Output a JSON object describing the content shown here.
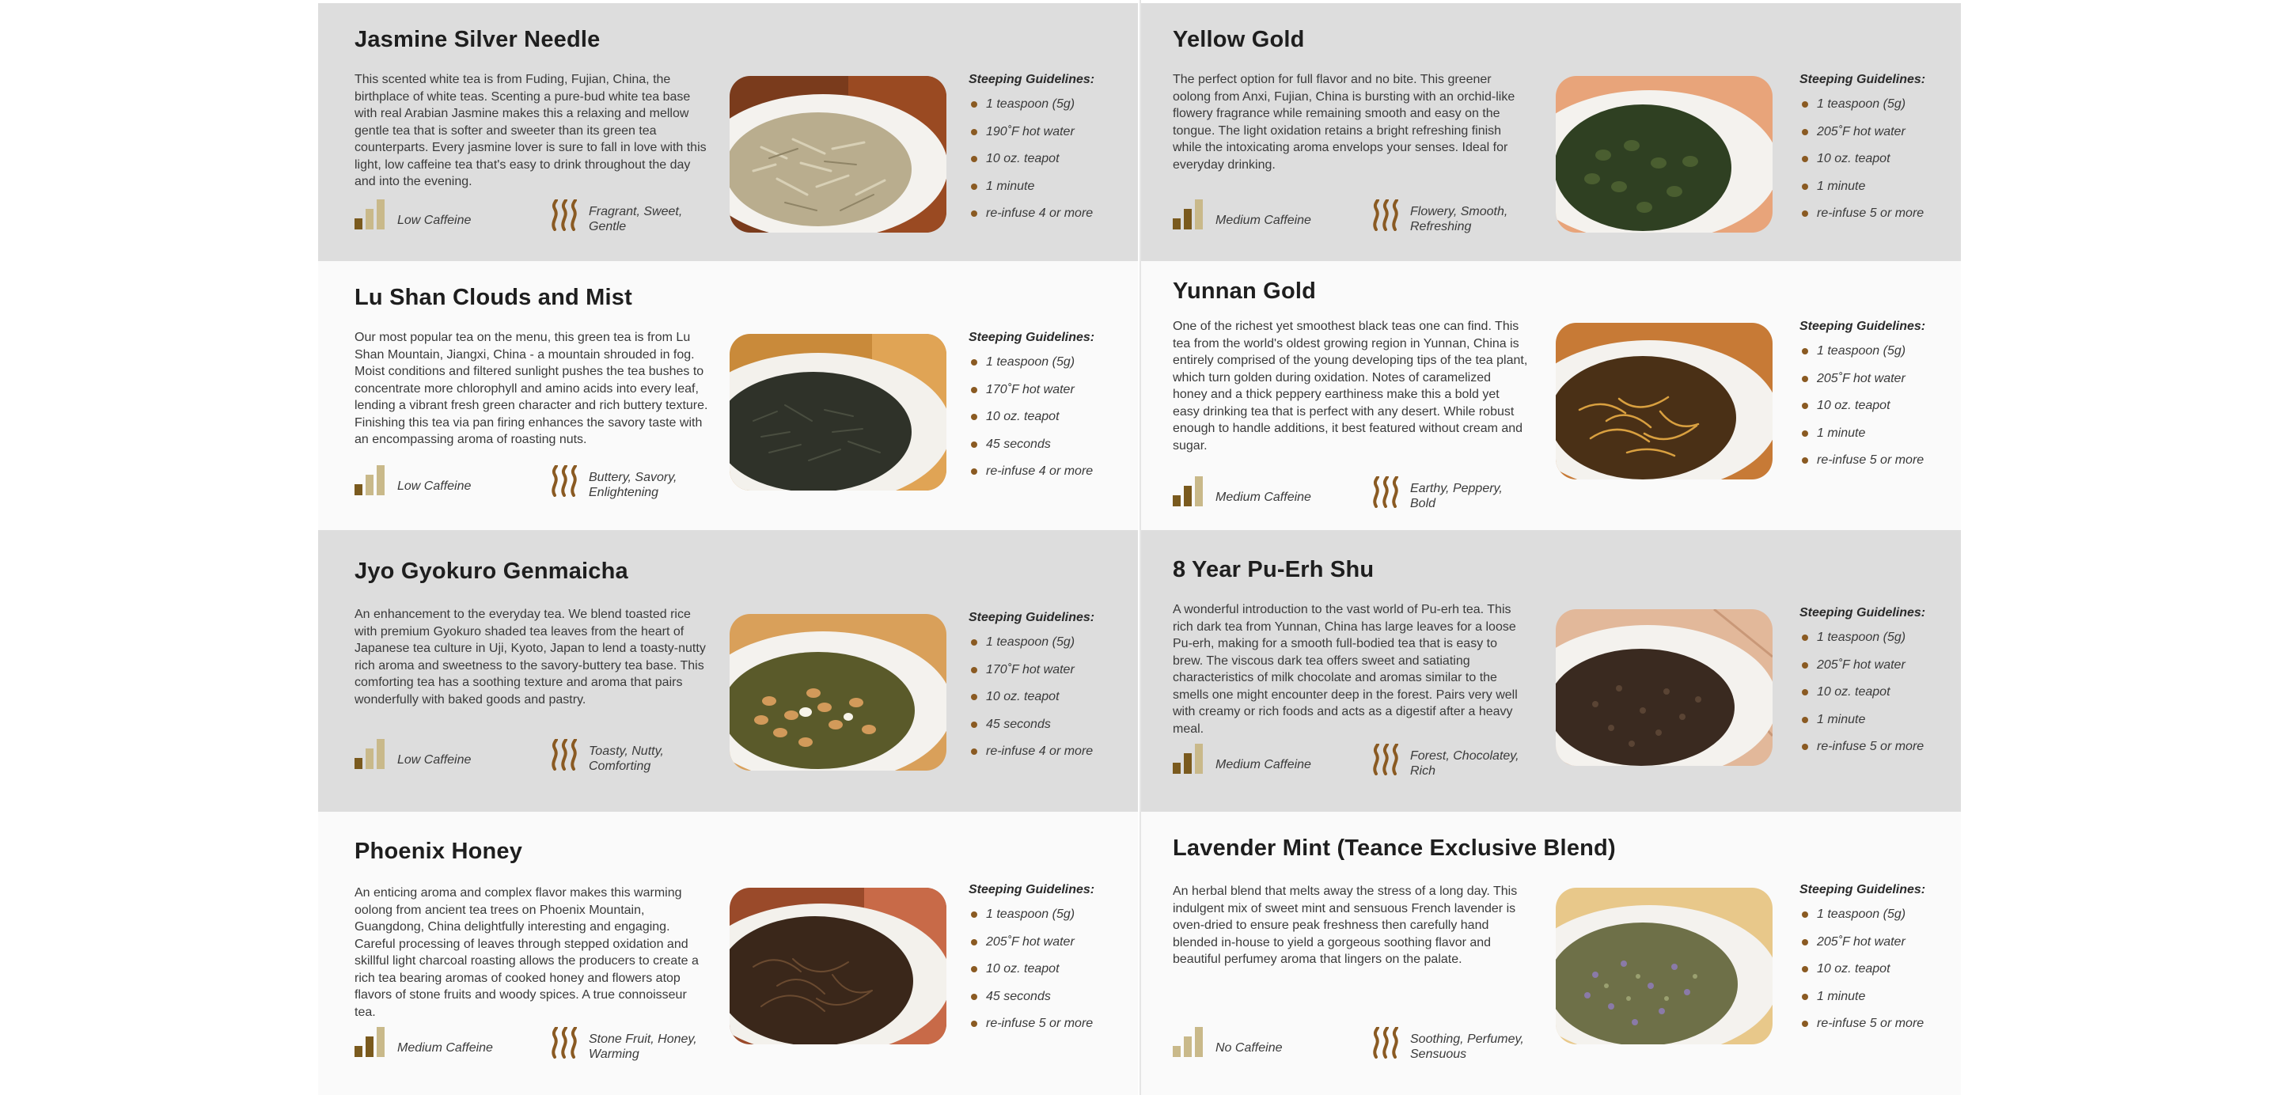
{
  "menu": {
    "steep_heading": "Steeping Guidelines:",
    "left_cards": [
      {
        "name": "Jasmine Silver Needle",
        "description": "This scented white tea is from Fuding, Fujian, China, the birthplace of white teas. Scenting a pure-bud white tea base with real Arabian Jasmine makes this a relaxing and mellow gentle tea that is softer and sweeter than its green tea counterparts. Every jasmine lover is sure to fall in love with this light, low caffeine tea that's easy to drink throughout the day and into the evening.",
        "steeping": [
          "1 teaspoon (5g)",
          "190˚F hot water",
          "10 oz. teapot",
          "1 minute",
          "re-infuse 4 or more"
        ],
        "caffeine": "Low Caffeine",
        "flavor": "Fragrant, Sweet, Gentle"
      },
      {
        "name": "Lu Shan Clouds and Mist",
        "description": "Our most popular tea on the menu, this green tea is from Lu Shan Mountain, Jiangxi, China - a mountain shrouded in fog. Moist conditions and filtered sunlight pushes the tea bushes to concentrate more chlorophyll and amino acids into every leaf, lending a vibrant fresh green character and rich buttery texture. Finishing this tea via pan firing enhances the savory taste with an encompassing aroma of roasting nuts.",
        "steeping": [
          "1 teaspoon (5g)",
          "170˚F hot water",
          "10 oz. teapot",
          "45 seconds",
          "re-infuse 4 or more"
        ],
        "caffeine": "Low Caffeine",
        "flavor": "Buttery, Savory, Enlightening"
      },
      {
        "name": "Jyo Gyokuro Genmaicha",
        "description": "An enhancement to the everyday tea. We blend toasted rice with premium Gyokuro shaded tea leaves from the heart of Japanese tea culture in Uji, Kyoto, Japan to lend a toasty-nutty rich aroma and sweetness to the savory-buttery tea base. This comforting tea has a soothing texture and aroma that pairs wonderfully with baked goods and pastry.",
        "steeping": [
          "1 teaspoon (5g)",
          "170˚F hot water",
          "10 oz. teapot",
          "45 seconds",
          "re-infuse 4 or more"
        ],
        "caffeine": "Low Caffeine",
        "flavor": "Toasty, Nutty, Comforting"
      },
      {
        "name": "Phoenix Honey",
        "description": "An enticing aroma and complex flavor makes this warming oolong from ancient tea trees on Phoenix Mountain, Guangdong, China delightfully interesting and engaging. Careful processing of leaves through stepped oxidation and skillful light charcoal roasting allows the producers to create a rich tea bearing aromas of cooked honey and flowers atop flavors of stone fruits and woody spices. A true connoisseur tea.",
        "steeping": [
          "1 teaspoon (5g)",
          "205˚F hot water",
          "10 oz. teapot",
          "45 seconds",
          "re-infuse 5 or more"
        ],
        "caffeine": "Medium Caffeine",
        "flavor": "Stone Fruit, Honey, Warming"
      }
    ],
    "right_cards": [
      {
        "name": "Yellow Gold",
        "description": "The perfect option for full flavor and no bite. This greener oolong from Anxi, Fujian, China is bursting with an orchid-like flowery fragrance while remaining smooth and easy on the tongue. The light oxidation retains a bright refreshing finish while the intoxicating aroma envelops your senses. Ideal for everyday drinking.",
        "steeping": [
          "1 teaspoon (5g)",
          "205˚F hot water",
          "10 oz. teapot",
          "1 minute",
          "re-infuse 5 or more"
        ],
        "caffeine": "Medium Caffeine",
        "flavor": "Flowery, Smooth, Refreshing"
      },
      {
        "name": "Yunnan Gold",
        "description": "One of the richest yet smoothest black teas one can find. This tea from the world's oldest growing region in Yunnan, China is entirely comprised of the young developing tips of the tea plant, which turn golden during oxidation. Notes of caramelized honey and a thick peppery earthiness make this a bold yet easy drinking tea that is perfect with any desert. While robust enough to handle additions, it best featured without cream and sugar.",
        "steeping": [
          "1 teaspoon (5g)",
          "205˚F hot water",
          "10 oz. teapot",
          "1 minute",
          "re-infuse 5 or more"
        ],
        "caffeine": "Medium Caffeine",
        "flavor": "Earthy, Peppery, Bold"
      },
      {
        "name": "8 Year Pu-Erh Shu",
        "description": "A wonderful introduction to the vast world of Pu-erh tea. This rich dark tea from Yunnan, China has large leaves for a loose Pu-erh, making for a smooth full-bodied tea that is easy to brew. The viscous dark tea offers sweet and satiating characteristics of milk chocolate and aromas similar to the smells one might encounter deep in the forest. Pairs very well with creamy or rich foods and acts as a digestif after a heavy meal.",
        "steeping": [
          "1 teaspoon (5g)",
          "205˚F hot water",
          "10 oz. teapot",
          "1 minute",
          "re-infuse 5 or more"
        ],
        "caffeine": "Medium Caffeine",
        "flavor": "Forest, Chocolatey, Rich"
      },
      {
        "name": "Lavender Mint (Teance Exclusive Blend)",
        "description": "An herbal blend that melts away the stress of a long day. This indulgent mix of sweet mint and sensuous French lavender is oven-dried to ensure peak freshness then carefully hand blended in-house to yield a gorgeous soothing flavor and beautiful perfumey aroma that lingers on the palate.",
        "steeping": [
          "1 teaspoon (5g)",
          "205˚F hot water",
          "10 oz. teapot",
          "1 minute",
          "re-infuse 5 or more"
        ],
        "caffeine": "No Caffeine",
        "flavor": "Soothing, Perfumey, Sensuous"
      }
    ]
  },
  "colors": {
    "shaded_card": "#dddddd",
    "light_card": "#fafafa",
    "accent_brown": "#8a5a22",
    "caffeine_on": "#7a5a1e",
    "caffeine_off": "#c9b98a"
  }
}
